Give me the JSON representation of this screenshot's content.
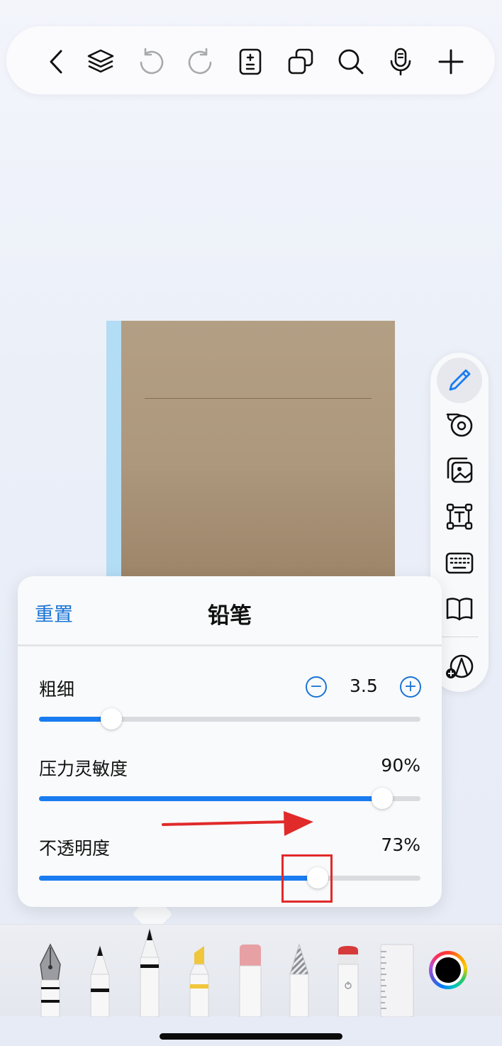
{
  "top_toolbar": {
    "buttons": [
      {
        "name": "back-button",
        "icon": "chevron-left-icon"
      },
      {
        "name": "layers-button",
        "icon": "layers-icon"
      },
      {
        "name": "undo-button",
        "icon": "undo-icon"
      },
      {
        "name": "redo-button",
        "icon": "redo-icon"
      },
      {
        "name": "page-manage-button",
        "icon": "page-plus-minus-icon"
      },
      {
        "name": "copy-button",
        "icon": "copy-icon"
      },
      {
        "name": "search-button",
        "icon": "search-icon"
      },
      {
        "name": "voice-button",
        "icon": "microphone-icon"
      },
      {
        "name": "add-button",
        "icon": "plus-icon"
      }
    ]
  },
  "side_toolbar": {
    "items": [
      {
        "name": "pen-tool",
        "icon": "pencil-icon",
        "active": true
      },
      {
        "name": "audio-recorder",
        "icon": "tape-record-icon"
      },
      {
        "name": "insert-image",
        "icon": "image-icon"
      },
      {
        "name": "text-box",
        "icon": "text-box-icon"
      },
      {
        "name": "keyboard",
        "icon": "keyboard-icon"
      },
      {
        "name": "reader",
        "icon": "book-icon"
      },
      {
        "name": "add-shapes",
        "icon": "shapes-plus-icon"
      }
    ]
  },
  "pen_settings": {
    "reset_label": "重置",
    "title": "铅笔",
    "thickness": {
      "label": "粗细",
      "value": "3.5",
      "fraction": 0.19
    },
    "pressure": {
      "label": "压力灵敏度",
      "value": "90%",
      "fraction": 0.9
    },
    "opacity": {
      "label": "不透明度",
      "value": "73%",
      "fraction": 0.73
    }
  },
  "tool_tray": {
    "tools": [
      {
        "name": "fountain-pen",
        "icon": "fountain-pen-icon"
      },
      {
        "name": "ballpoint-pen",
        "icon": "ballpoint-pen-icon"
      },
      {
        "name": "pencil",
        "icon": "pencil-tool-icon",
        "selected": true
      },
      {
        "name": "highlighter",
        "icon": "highlighter-icon"
      },
      {
        "name": "eraser",
        "icon": "eraser-icon"
      },
      {
        "name": "lasso",
        "icon": "lasso-icon"
      },
      {
        "name": "color-marker",
        "icon": "marker-icon"
      },
      {
        "name": "ruler",
        "icon": "ruler-icon"
      }
    ],
    "current_color": "#000000"
  },
  "colors": {
    "accent": "#1a74d6",
    "slider_fill": "#1a7cf0",
    "annotation": "#e12a2a",
    "notebook_cover": "#ad987d",
    "notebook_spine": "#b3dcf5"
  }
}
